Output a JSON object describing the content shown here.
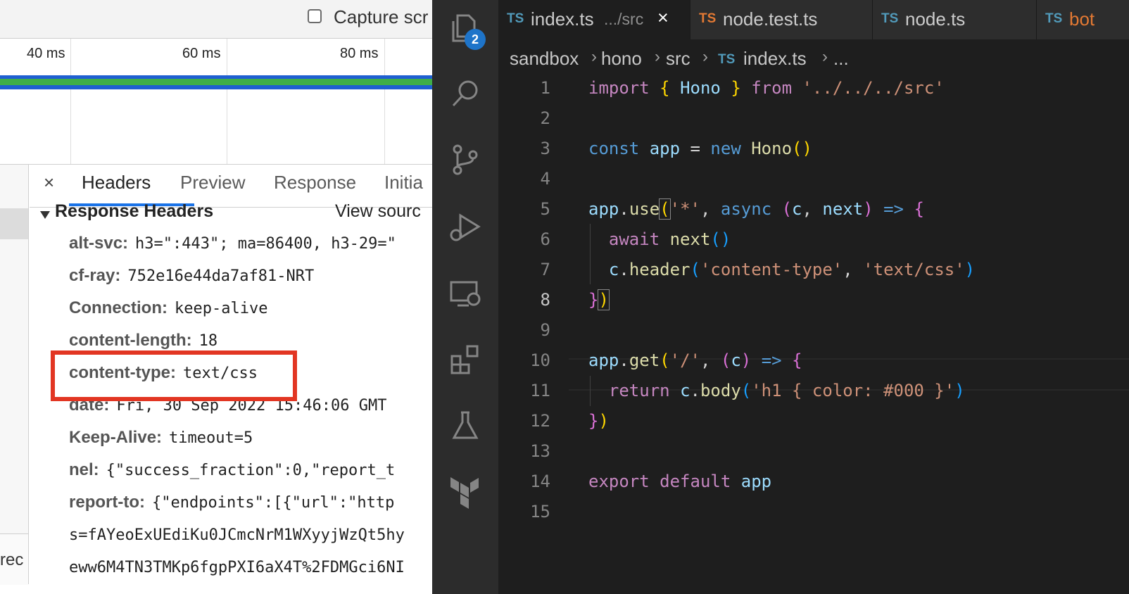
{
  "devtools": {
    "capture_label": "Capture scr",
    "ticks": [
      "40 ms",
      "60 ms",
      "80 ms"
    ],
    "request_list_partial": "rec",
    "tabs": [
      "Headers",
      "Preview",
      "Response",
      "Initia"
    ],
    "active_tab": "Headers",
    "close_label": "×",
    "section_title": "Response Headers",
    "view_source": "View sourc",
    "headers": [
      {
        "name": "alt-svc:",
        "value": "h3=\":443\"; ma=86400, h3-29=\""
      },
      {
        "name": "cf-ray:",
        "value": "752e16e44da7af81-NRT"
      },
      {
        "name": "Connection:",
        "value": "keep-alive"
      },
      {
        "name": "content-length:",
        "value": "18"
      },
      {
        "name": "content-type:",
        "value": "text/css"
      },
      {
        "name": "date:",
        "value": "Fri, 30 Sep 2022 15:46:06 GMT"
      },
      {
        "name": "Keep-Alive:",
        "value": "timeout=5"
      },
      {
        "name": "nel:",
        "value": "{\"success_fraction\":0,\"report_t"
      },
      {
        "name": "report-to:",
        "value": "{\"endpoints\":[{\"url\":\"http"
      }
    ],
    "report_to_cont1": "s=fAYeoExUEdiKu0JCmcNrM1WXyyjWzQt5hy",
    "report_to_cont2": "eww6M4TN3TMKp6fgpPXI6aX4T%2FDMGci6NI"
  },
  "vscode": {
    "scm_badge": "2",
    "tabs": [
      {
        "badge": "TS",
        "name": "index.ts",
        "path": ".../src",
        "close": "×"
      },
      {
        "badge": "TS",
        "name": "node.test.ts"
      },
      {
        "badge": "TS",
        "name": "node.ts"
      },
      {
        "badge": "TS",
        "name": "bot"
      }
    ],
    "breadcrumbs": [
      "sandbox",
      "hono",
      "src",
      "index.ts",
      "..."
    ],
    "breadcrumb_badge": "TS",
    "line_numbers": [
      "1",
      "2",
      "3",
      "4",
      "5",
      "6",
      "7",
      "8",
      "9",
      "10",
      "11",
      "12",
      "13",
      "14",
      "15"
    ],
    "code": {
      "l1": {
        "import": "import",
        "ob": "{",
        "name": "Hono",
        "cb": "}",
        "from": "from",
        "path": "'../../../src'"
      },
      "l3": {
        "const": "const",
        "app": "app",
        "eq": "=",
        "new": "new",
        "cls": "Hono",
        "paren": "()"
      },
      "l5": {
        "app": "app",
        "dot": ".",
        "use": "use",
        "op": "(",
        "arg": "'*'",
        "comma": ",",
        "async": "async",
        "pop": "(",
        "c": "c",
        "comma2": ",",
        "next": "next",
        "pcl": ")",
        "arrow": "=>",
        "brace": "{"
      },
      "l6": {
        "await": "await",
        "next": "next",
        "paren": "()"
      },
      "l7": {
        "c": "c",
        "dot": ".",
        "header": "header",
        "op": "(",
        "a1": "'content-type'",
        "comma": ",",
        "a2": "'text/css'",
        "cp": ")"
      },
      "l8": {
        "brace": "}",
        "paren": ")"
      },
      "l10": {
        "app": "app",
        "dot": ".",
        "get": "get",
        "op": "(",
        "arg": "'/'",
        "comma": ",",
        "pop": "(",
        "c": "c",
        "pcl": ")",
        "arrow": "=>",
        "brace": "{"
      },
      "l11": {
        "ret": "return",
        "c": "c",
        "dot": ".",
        "body": "body",
        "op": "(",
        "arg": "'h1 { color: #000 }'",
        "cp": ")"
      },
      "l12": {
        "brace": "}",
        "paren": ")"
      },
      "l14": {
        "export": "export",
        "def": "default",
        "app": "app"
      }
    }
  }
}
